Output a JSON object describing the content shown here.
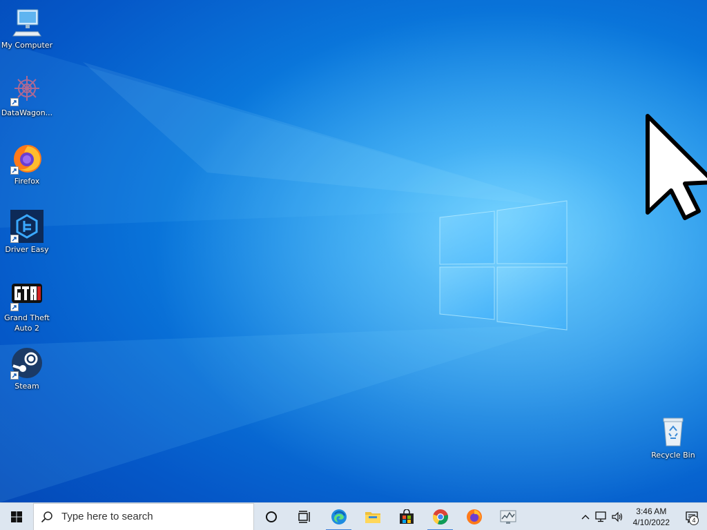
{
  "desktop": {
    "icons": [
      {
        "label": "My Computer"
      },
      {
        "label": "DataWagon..."
      },
      {
        "label": "Firefox"
      },
      {
        "label": "Driver Easy"
      },
      {
        "label": "Grand Theft Auto 2"
      },
      {
        "label": "Steam"
      },
      {
        "label": "Recycle Bin"
      }
    ]
  },
  "taskbar": {
    "search_placeholder": "Type here to search",
    "apps": [
      "cortana-circle-icon",
      "task-view-icon",
      "edge-icon",
      "file-explorer-icon",
      "microsoft-store-icon",
      "chrome-icon",
      "firefox-icon",
      "system-monitor-icon"
    ],
    "clock": {
      "time": "3:46 AM",
      "date": "4/10/2022"
    },
    "notification_count": "4",
    "accent_color": "#3b7dd8"
  },
  "colors": {
    "taskbar_bg": "#dde6f0",
    "wallpaper_primary": "#0a78dc"
  }
}
